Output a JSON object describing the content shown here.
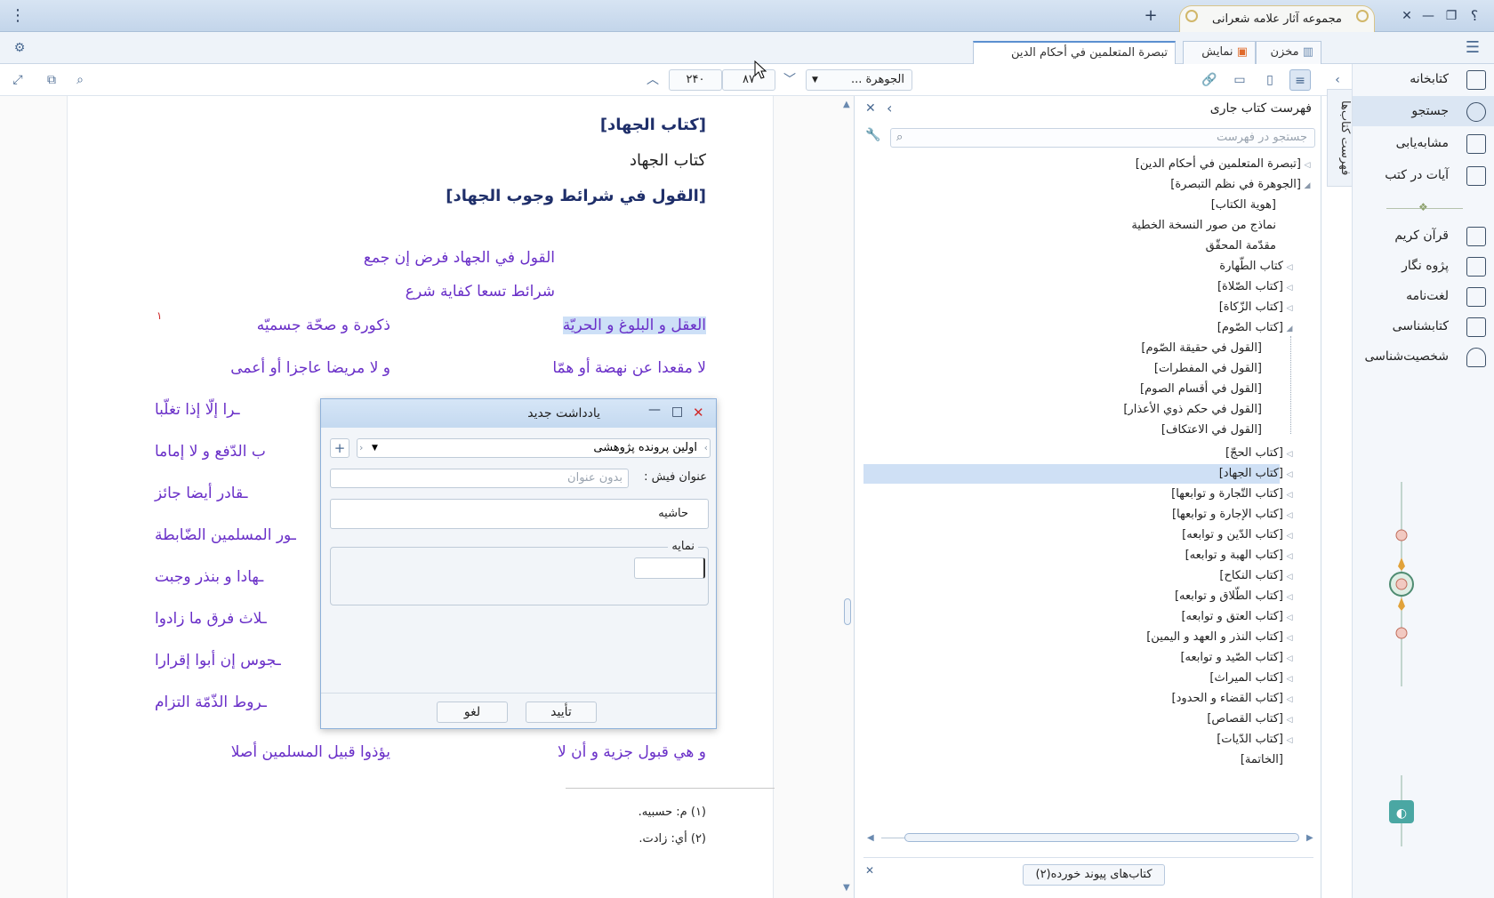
{
  "window": {
    "app_tab_title": "مجموعه آثار علامه شعرانی",
    "help_glyph": "؟",
    "menu_glyph": "⋮",
    "new_tab_glyph": "+"
  },
  "tabs": {
    "repository": "مخزن",
    "display": "نمایش",
    "book_tab": "تبصرة المتعلمين في أحكام الدين"
  },
  "toolbar": {
    "book_select": "الجوهرة ...",
    "page_current": "۸۷",
    "page_total": "۲۴۰"
  },
  "sidebar": {
    "items": [
      {
        "label": "کتابخانه",
        "icon": "books-icon"
      },
      {
        "label": "جستجو",
        "icon": "search-icon"
      },
      {
        "label": "مشابه‌یابی",
        "icon": "similar-icon"
      },
      {
        "label": "آیات در کتب",
        "icon": "verses-icon"
      },
      {
        "label": "قرآن کریم",
        "icon": "quran-icon"
      },
      {
        "label": "پژوه نگار",
        "icon": "research-icon"
      },
      {
        "label": "لغت‌نامه",
        "icon": "dictionary-icon"
      },
      {
        "label": "کتابشناسی",
        "icon": "bibliography-icon"
      },
      {
        "label": "شخصیت‌شناسی",
        "icon": "person-icon"
      }
    ],
    "vertical_tab": "فهرست کتاب‌ها"
  },
  "toc": {
    "title": "فهرست كتاب جاری",
    "search_placeholder": "جستجو در فهرست",
    "items": [
      {
        "label": "[تبصرة المتعلمين في أحكام الدين]",
        "level": 0,
        "arrow": "◁"
      },
      {
        "label": "[الجوهرة في نظم التبصرة]",
        "level": 1,
        "arrow": "◢"
      },
      {
        "label": "[هوية الكتاب]",
        "level": 2,
        "arrow": ""
      },
      {
        "label": "نماذج من صور النسخة الخطية",
        "level": 2,
        "arrow": ""
      },
      {
        "label": "مقدّمة المحقّق",
        "level": 2,
        "arrow": ""
      },
      {
        "label": "كتاب الطّهارة",
        "level": 2,
        "arrow": "◁"
      },
      {
        "label": "[كتاب الصّلاة]",
        "level": 2,
        "arrow": "◁"
      },
      {
        "label": "[كتاب الزّكاة]",
        "level": 2,
        "arrow": "◁"
      },
      {
        "label": "[كتاب الصّوم]",
        "level": 2,
        "arrow": "◢"
      },
      {
        "label": "[القول في حقيقة الصّوم]",
        "level": 3,
        "arrow": ""
      },
      {
        "label": "[القول في المفطرات]",
        "level": 3,
        "arrow": ""
      },
      {
        "label": "[القول في أقسام الصوم]",
        "level": 3,
        "arrow": ""
      },
      {
        "label": "[القول في حكم ذوي الأعذار]",
        "level": 3,
        "arrow": ""
      },
      {
        "label": "[القول في الاعتكاف]",
        "level": 3,
        "arrow": ""
      },
      {
        "label": "[كتاب الحجّ]",
        "level": 2,
        "arrow": "◁"
      },
      {
        "label": "[كتاب الجهاد]",
        "level": 2,
        "arrow": "◁",
        "selected": true
      },
      {
        "label": "[كتاب التّجارة و توابعها]",
        "level": 2,
        "arrow": "◁"
      },
      {
        "label": "[كتاب الإجارة و توابعها]",
        "level": 2,
        "arrow": "◁"
      },
      {
        "label": "[كتاب الدّين و توابعه]",
        "level": 2,
        "arrow": "◁"
      },
      {
        "label": "[كتاب الهبة و توابعه]",
        "level": 2,
        "arrow": "◁"
      },
      {
        "label": "[كتاب النكاح]",
        "level": 2,
        "arrow": "◁"
      },
      {
        "label": "[كتاب الطّلاق و توابعه]",
        "level": 2,
        "arrow": "◁"
      },
      {
        "label": "[كتاب العتق و توابعه]",
        "level": 2,
        "arrow": "◁"
      },
      {
        "label": "[كتاب النذر و العهد و اليمين]",
        "level": 2,
        "arrow": "◁"
      },
      {
        "label": "[كتاب الصّيد و توابعه]",
        "level": 2,
        "arrow": "◁"
      },
      {
        "label": "[كتاب الميراث]",
        "level": 2,
        "arrow": "◁"
      },
      {
        "label": "[كتاب القضاء و الحدود]",
        "level": 2,
        "arrow": "◁"
      },
      {
        "label": "[كتاب القصاص]",
        "level": 2,
        "arrow": "◁"
      },
      {
        "label": "[كتاب الدّيات]",
        "level": 2,
        "arrow": "◁"
      },
      {
        "label": "[الخاتمة]",
        "level": 2,
        "arrow": ""
      }
    ],
    "linked_books": "کتاب‌های پیوند خورده(۲)"
  },
  "book": {
    "heading1": "[كتاب الجهاد]",
    "heading2": "كتاب الجهاد",
    "heading3": "[القول في شرائط وجوب الجهاد]",
    "center_lines": [
      "القول في الجهاد فرض إن جمع",
      "شرائط تسعا كفاية شرع"
    ],
    "rows": [
      {
        "right": "العقل و البلوغ و الحريّة",
        "left": "ذكورة و صحّة جسميّه"
      },
      {
        "right": "لا مقعدا عن نهضة أو همّا",
        "left": "و لا مريضا عاجزا أو أعمى"
      },
      {
        "right": "",
        "left": "ـرا إلّا إذا تغلّبا"
      },
      {
        "right": "",
        "left": "ب الدّفع و لا إماما"
      },
      {
        "right": "",
        "left": "ـقادر أيضا جائز"
      },
      {
        "right": "",
        "left": "ـور المسلمين الضّابطة"
      },
      {
        "right": "",
        "left": "ـهادا و بنذر وجبت"
      },
      {
        "right": "",
        "left": "ـلاث فرق ما زادوا"
      },
      {
        "right": "",
        "left": "ـجوس إن أبوا إقرارا"
      },
      {
        "right": "",
        "left": "ـروط الذّمّة التزام"
      },
      {
        "right": "و هي قبول جزية و أن لا",
        "left": "يؤذوا قبيل المسلمين أصلا"
      }
    ],
    "footnote_mark": "١",
    "footnotes": [
      "(١)  م: حسبيه.",
      "(٢)  أي: زادت."
    ]
  },
  "dialog": {
    "title": "یادداشت جدید",
    "research_file": "اولین پرونده پژوهشی",
    "add_glyph": "+",
    "card_title_label": "عنوان فیش :",
    "card_title_placeholder": "بدون عنوان",
    "card_type": "حاشیه",
    "index_label": "نمایه",
    "confirm": "تأیید",
    "cancel": "لغو"
  }
}
